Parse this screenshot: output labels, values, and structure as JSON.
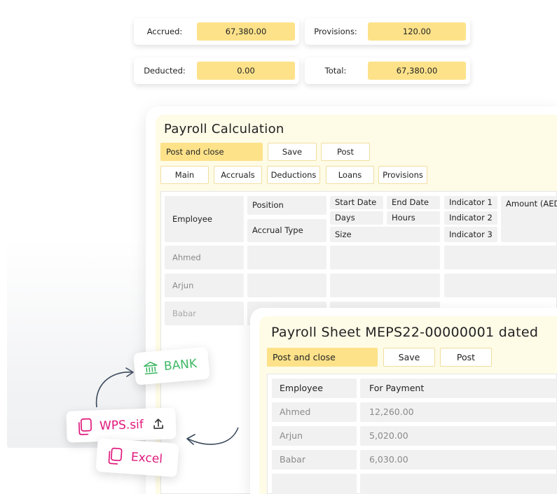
{
  "summary": {
    "accrued": {
      "label": "Accrued:",
      "value": "67,380.00"
    },
    "provisions": {
      "label": "Provisions:",
      "value": "120.00"
    },
    "deducted": {
      "label": "Deducted:",
      "value": "0.00"
    },
    "total": {
      "label": "Total:",
      "value": "67,380.00"
    }
  },
  "calc": {
    "title": "Payroll Calculation",
    "buttons": {
      "post_close": "Post and close",
      "save": "Save",
      "post": "Post"
    },
    "tabs": [
      "Main",
      "Accruals",
      "Deductions",
      "Loans",
      "Provisions"
    ],
    "headers": {
      "employee": "Employee",
      "position": "Position",
      "accrual_type": "Accrual Type",
      "start_date": "Start Date",
      "end_date": "End Date",
      "days": "Days",
      "hours": "Hours",
      "size": "Size",
      "ind1": "Indicator 1",
      "ind2": "Indicator 2",
      "ind3": "Indicator 3",
      "amount": "Amount (AED)"
    },
    "rows": [
      "Ahmed",
      "Arjun",
      "Babar"
    ]
  },
  "sheet": {
    "title": "Payroll Sheet MEPS22-00000001 dated",
    "buttons": {
      "post_close": "Post and close",
      "save": "Save",
      "post": "Post"
    },
    "headers": {
      "employee": "Employee",
      "payment": "For Payment"
    },
    "rows": [
      {
        "employee": "Ahmed",
        "payment": "12,260.00"
      },
      {
        "employee": "Arjun",
        "payment": "5,020.00"
      },
      {
        "employee": "Babar",
        "payment": "6,030.00"
      }
    ]
  },
  "exports": {
    "bank": "BANK",
    "wps": "WPS.sif",
    "excel": "Excel"
  },
  "colors": {
    "accent": "#fde28a",
    "panel_bg": "#fefbe7",
    "bank_green": "#3fb865",
    "file_pink": "#e0197d"
  },
  "icons": [
    "bank-icon",
    "file-copy-icon",
    "upload-icon",
    "curved-arrow-icon"
  ]
}
